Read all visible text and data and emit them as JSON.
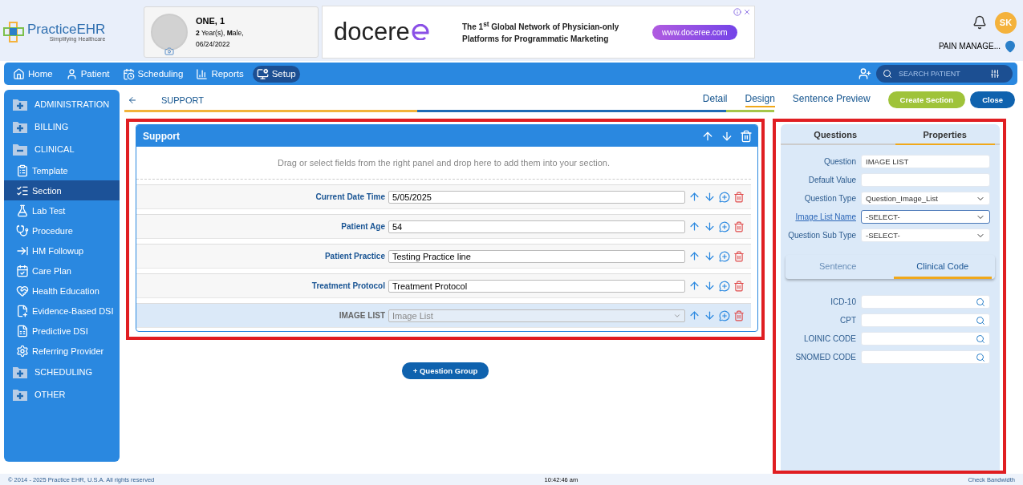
{
  "header": {
    "logo": {
      "name": "PracticeEHR",
      "tagline": "Simplifying Healthcare"
    },
    "patient": {
      "name": "ONE, 1",
      "details": "**2** Year(s), **M**ale,",
      "dob": "06/24/2022"
    },
    "ad": {
      "brand": "docere",
      "text": "The 1$^{st}$ Global Network of Physician-only Platforms for Programmatic Marketing",
      "link": "www.doceree.com"
    },
    "user": {
      "initials": "SK",
      "location": "PAIN MANAGE..."
    }
  },
  "nav": {
    "items": [
      {
        "label": "Home",
        "selected": false
      },
      {
        "label": "Patient",
        "selected": false
      },
      {
        "label": "Scheduling",
        "selected": false
      },
      {
        "label": "Reports",
        "selected": false
      },
      {
        "label": "Setup",
        "selected": true
      }
    ],
    "search": {
      "placeholder": "SEARCH PATIENT"
    }
  },
  "sidebar": {
    "items": [
      {
        "label": "ADMINISTRATION",
        "expanded": false
      },
      {
        "label": "BILLING",
        "expanded": false
      },
      {
        "label": "CLINICAL",
        "expanded": true,
        "children": [
          {
            "label": "Template",
            "selected": false
          },
          {
            "label": "Section",
            "selected": true
          },
          {
            "label": "Lab Test",
            "selected": false
          },
          {
            "label": "Procedure",
            "selected": false
          },
          {
            "label": "HM Followup",
            "selected": false
          },
          {
            "label": "Care Plan",
            "selected": false
          },
          {
            "label": "Health Education",
            "selected": false
          },
          {
            "label": "Evidence-Based DSI",
            "selected": false
          },
          {
            "label": "Predictive DSI",
            "selected": false
          },
          {
            "label": "Referring Provider",
            "selected": false
          }
        ]
      },
      {
        "label": "SCHEDULING",
        "expanded": false
      },
      {
        "label": "OTHER",
        "expanded": false
      }
    ]
  },
  "toolbar": {
    "title": "SUPPORT",
    "tabs": [
      {
        "label": "Detail",
        "selected": false
      },
      {
        "label": "Design",
        "selected": true
      },
      {
        "label": "Sentence Preview",
        "selected": false
      }
    ],
    "buttons": [
      {
        "label": "Create Section",
        "kind": "create"
      },
      {
        "label": "Close",
        "kind": "close"
      }
    ]
  },
  "section": {
    "title": "Support",
    "hint": "Drag or select fields from the right panel and drop here to add them into your section.",
    "questions": [
      {
        "label": "Current Date Time",
        "value": "5/05/2025",
        "kind": "text",
        "selected": false
      },
      {
        "label": "Patient Age",
        "value": "54",
        "kind": "text",
        "selected": false
      },
      {
        "label": "Patient Practice",
        "value": "Testing Practice line",
        "kind": "text",
        "selected": false
      },
      {
        "label": "Treatment Protocol",
        "value": "Treatment Protocol",
        "kind": "text",
        "selected": false
      },
      {
        "label": "IMAGE LIST",
        "value": "Image List",
        "kind": "select",
        "selected": true
      }
    ],
    "add_button": "+ Question Group"
  },
  "properties": {
    "tabs": [
      {
        "label": "Questions",
        "selected": false
      },
      {
        "label": "Properties",
        "selected": true
      }
    ],
    "fields": [
      {
        "label": "Question",
        "value": "IMAGE LIST",
        "kind": "text",
        "link": false,
        "focused": false
      },
      {
        "label": "Default Value",
        "kind": "text",
        "link": false,
        "focused": false
      },
      {
        "label": "Question Type",
        "value": "Question_Image_List",
        "kind": "select",
        "link": false,
        "focused": false
      },
      {
        "label": "Image List Name",
        "value": "-SELECT-",
        "kind": "select",
        "link": true,
        "focused": true
      },
      {
        "label": "Question Sub Type",
        "value": "-SELECT-",
        "kind": "select",
        "link": false,
        "focused": false
      }
    ],
    "subtabs": [
      {
        "label": "Sentence",
        "selected": false
      },
      {
        "label": "Clinical Code",
        "selected": true
      }
    ],
    "codes": [
      {
        "label": "ICD-10"
      },
      {
        "label": "CPT"
      },
      {
        "label": "LOINIC CODE"
      },
      {
        "label": "SNOMED CODE"
      }
    ]
  },
  "footer": {
    "copyright": "© 2014 - 2025 Practice EHR, U.S.A. All rights reserved",
    "time": "10:42:46 am",
    "link": "Check Bandwidth"
  }
}
